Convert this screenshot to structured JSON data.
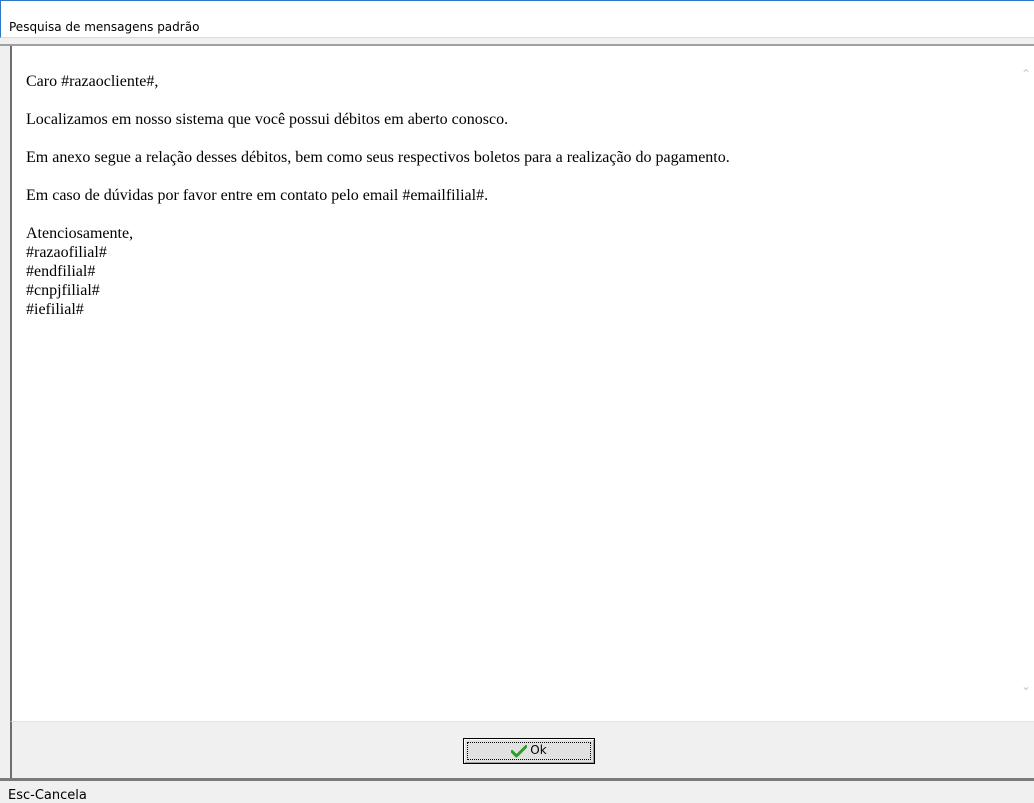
{
  "window": {
    "title": "Pesquisa de mensagens padrão"
  },
  "message": {
    "greeting": "Caro #razaocliente#,",
    "paragraph1": "Localizamos em nosso sistema que você possui débitos em aberto conosco.",
    "paragraph2": "Em anexo segue a relação desses débitos, bem como seus respectivos boletos para a realização do pagamento.",
    "paragraph3": "Em caso de dúvidas por favor entre em contato pelo email #emailfilial#.",
    "signature": [
      "Atenciosamente,",
      "#razaofilial#",
      "#endfilial#",
      "#cnpjfilial#",
      "#iefilial#"
    ]
  },
  "buttons": {
    "ok_label": "Ok",
    "ok_icon": "check-icon",
    "ok_icon_color": "#2a9d2a"
  },
  "statusbar": {
    "text": "Esc-Cancela"
  },
  "scrollbar": {
    "up_glyph": "⌃",
    "down_glyph": "⌄"
  }
}
